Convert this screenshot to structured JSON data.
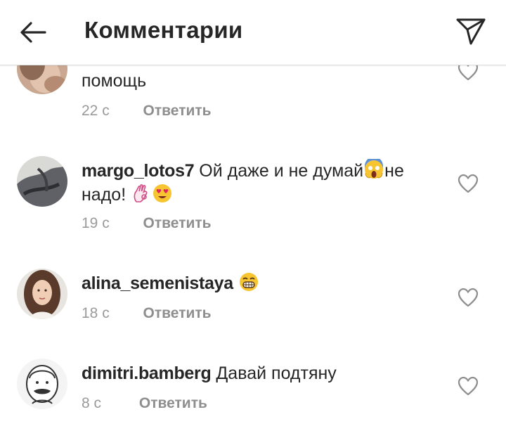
{
  "header": {
    "title": "Комментарии"
  },
  "comments": [
    {
      "username": "",
      "text": "помощь",
      "time": "22 с",
      "reply_label": "Ответить"
    },
    {
      "username": "margo_lotos7",
      "text": "Ой даже и не думай",
      "text_after_emoji": "не надо!",
      "time": "19 с",
      "reply_label": "Ответить",
      "emojis": [
        "screaming-face-emoji",
        "ok-hand-emoji",
        "heart-eyes-emoji"
      ]
    },
    {
      "username": "alina_semenistaya",
      "text": "",
      "time": "18 с",
      "reply_label": "Ответить",
      "emojis": [
        "grinning-face-emoji"
      ]
    },
    {
      "username": "dimitri.bamberg",
      "text": "Давай подтяну",
      "time": "8 с",
      "reply_label": "Ответить"
    }
  ],
  "colors": {
    "text": "#262626",
    "meta": "#9a9a9a",
    "divider": "#dbdbdb"
  },
  "icons": [
    "back-arrow-icon",
    "direct-share-icon",
    "heart-outline-icon"
  ]
}
